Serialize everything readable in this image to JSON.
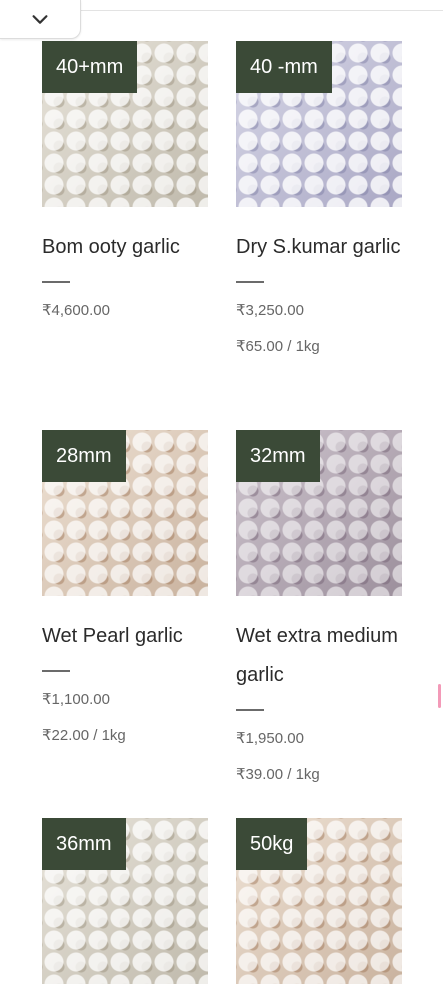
{
  "header": {
    "collapse_icon": "chevron-down-icon"
  },
  "products": [
    {
      "badge": "40+mm",
      "title": "Bom ooty garlic",
      "price": "₹4,600.00",
      "unit_price": ""
    },
    {
      "badge": "40 -mm",
      "title": "Dry S.kumar garlic",
      "price": "₹3,250.00",
      "unit_price": "₹65.00 / 1kg"
    },
    {
      "badge": "28mm",
      "title": "Wet Pearl garlic",
      "price": "₹1,100.00",
      "unit_price": "₹22.00 / 1kg"
    },
    {
      "badge": "32mm",
      "title": "Wet extra medium garlic",
      "price": "₹1,950.00",
      "unit_price": "₹39.00 / 1kg"
    },
    {
      "badge": "36mm",
      "title": "",
      "price": "",
      "unit_price": ""
    },
    {
      "badge": "50kg",
      "title": "",
      "price": "",
      "unit_price": ""
    }
  ],
  "colors": {
    "badge_bg": "#3b4a37",
    "scroll_marker": "#f39ab8"
  }
}
